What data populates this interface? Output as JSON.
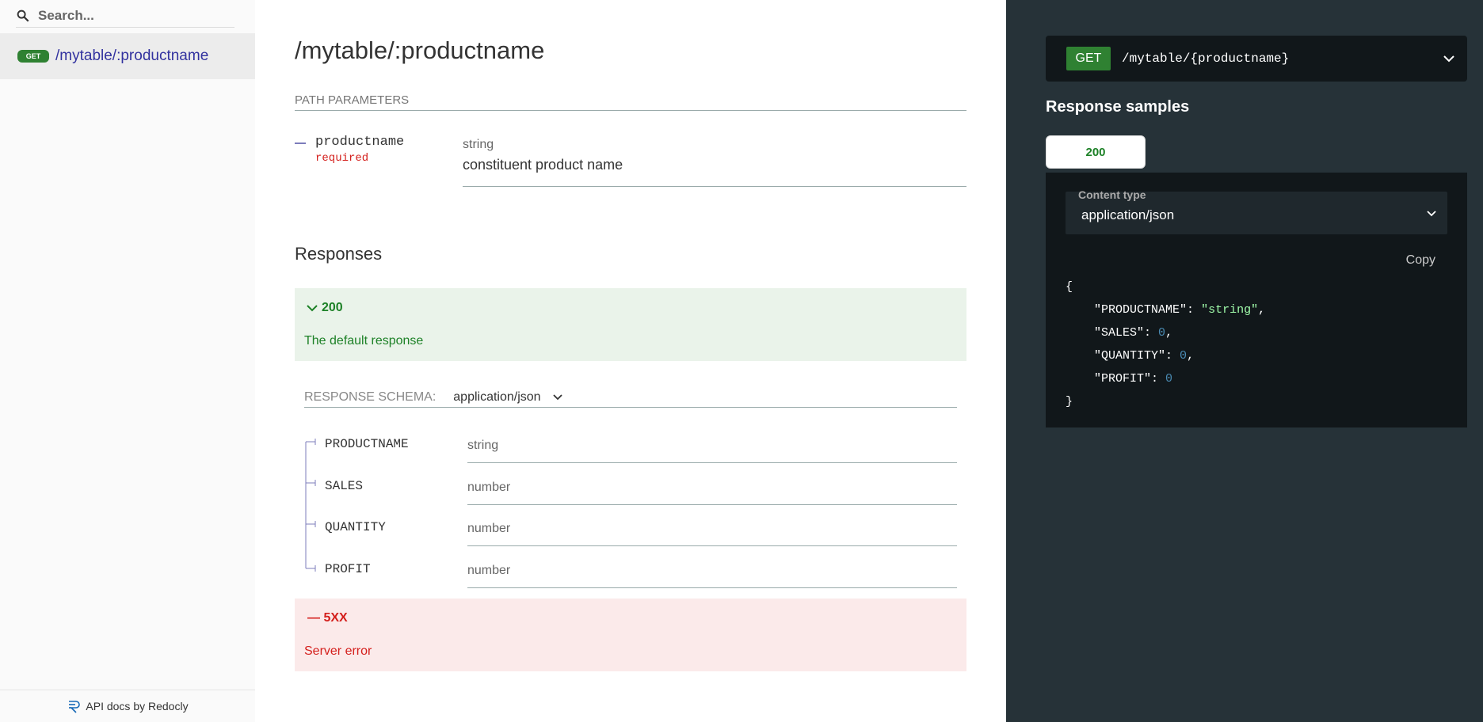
{
  "sidebar": {
    "search_placeholder": "Search...",
    "items": [
      {
        "method": "GET",
        "label": "/mytable/:productname"
      }
    ],
    "footer": "API docs by Redocly"
  },
  "main": {
    "title": "/mytable/:productname",
    "path_parameters_label": "PATH PARAMETERS",
    "param": {
      "name": "productname",
      "required": "required",
      "type": "string",
      "description": "constituent product name"
    },
    "responses_title": "Responses",
    "response_200": {
      "code": "200",
      "description": "The default response"
    },
    "schema": {
      "label": "RESPONSE SCHEMA:",
      "content_type": "application/json",
      "fields": [
        {
          "name": "PRODUCTNAME",
          "type": "string"
        },
        {
          "name": "SALES",
          "type": "number"
        },
        {
          "name": "QUANTITY",
          "type": "number"
        },
        {
          "name": "PROFIT",
          "type": "number"
        }
      ]
    },
    "response_5xx": {
      "code": "— 5XX",
      "description": "Server error"
    }
  },
  "right_panel": {
    "method": "GET",
    "path": "/mytable/{productname}",
    "samples_title": "Response samples",
    "tab_label": "200",
    "content_type_label": "Content type",
    "content_type_value": "application/json",
    "copy_label": "Copy",
    "code": {
      "open": "{",
      "close": "}",
      "lines": [
        {
          "key": "\"PRODUCTNAME\"",
          "value": "\"string\"",
          "kind": "str",
          "comma": ","
        },
        {
          "key": "\"SALES\"",
          "value": "0",
          "kind": "num",
          "comma": ","
        },
        {
          "key": "\"QUANTITY\"",
          "value": "0",
          "kind": "num",
          "comma": ","
        },
        {
          "key": "\"PROFIT\"",
          "value": "0",
          "kind": "num",
          "comma": ""
        }
      ]
    }
  },
  "colors": {
    "get_badge": "#2f8132",
    "success_text": "#1d8127",
    "error_text": "#d41f1c",
    "right_panel_bg": "#263238",
    "link": "#32329f"
  }
}
